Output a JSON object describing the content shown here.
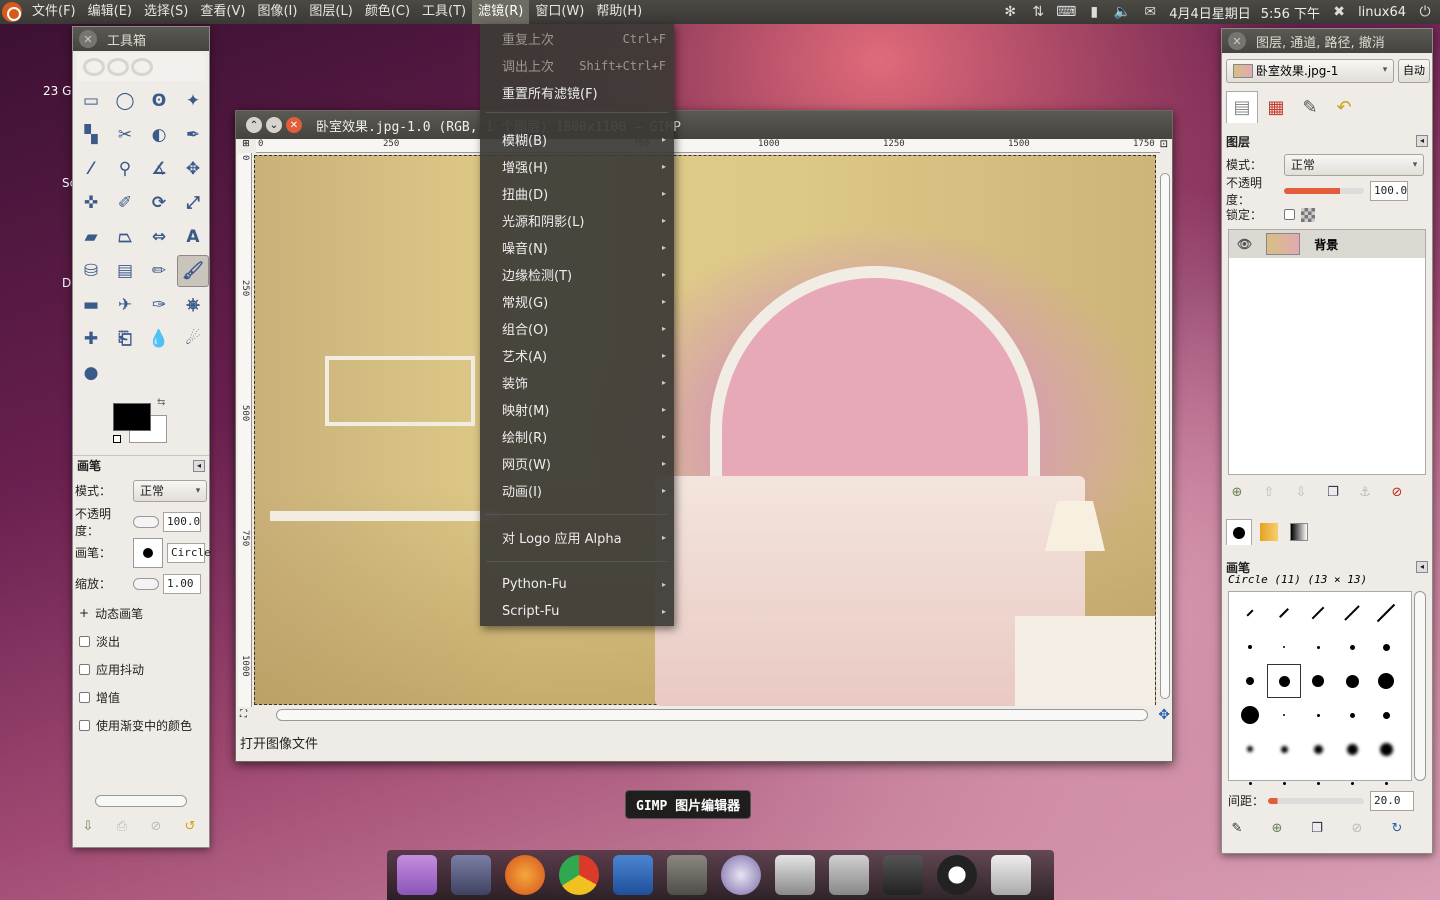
{
  "top_panel": {
    "menus": [
      "文件(F)",
      "编辑(E)",
      "选择(S)",
      "查看(V)",
      "图像(I)",
      "图层(L)",
      "颜色(C)",
      "工具(T)",
      "滤镜(R)",
      "窗口(W)",
      "帮助(H)"
    ],
    "active_menu": "滤镜(R)",
    "date": "4月4日星期日",
    "time": "5:56 下午",
    "user": "linux64"
  },
  "desktop": {
    "labels": [
      "23 G",
      "Sc",
      "Dc"
    ]
  },
  "toolbox": {
    "title": "工具箱",
    "brush_panel": {
      "title": "画笔",
      "mode_label": "模式：",
      "mode_value": "正常",
      "opacity_label": "不透明度：",
      "opacity_value": "100.0",
      "brush_label": "画笔：",
      "brush_value": "Circle",
      "scale_label": "缩放：",
      "scale_value": "1.00",
      "dynamics_label": "动态画笔",
      "checkboxes": [
        "淡出",
        "应用抖动",
        "增值",
        "使用渐变中的颜色"
      ]
    }
  },
  "image_window": {
    "title": "卧室效果.jpg-1.0 (RGB, 1 个图层) 1800x1100 – GIMP",
    "ruler_ticks": [
      "0",
      "250",
      "500",
      "750",
      "1000",
      "1250",
      "1500",
      "1750"
    ],
    "vruler_ticks": [
      "0",
      "250",
      "500",
      "750",
      "1000"
    ],
    "status": "打开图像文件"
  },
  "filters_menu": {
    "items": [
      {
        "label": "重复上次",
        "shortcut": "Ctrl+F",
        "disabled": true
      },
      {
        "label": "调出上次",
        "shortcut": "Shift+Ctrl+F",
        "disabled": true
      },
      {
        "label": "重置所有滤镜(F)",
        "shortcut": "",
        "disabled": false
      },
      {
        "label": "模糊(B)",
        "submenu": true
      },
      {
        "label": "增强(H)",
        "submenu": true
      },
      {
        "label": "扭曲(D)",
        "submenu": true
      },
      {
        "label": "光源和阴影(L)",
        "submenu": true
      },
      {
        "label": "噪音(N)",
        "submenu": true
      },
      {
        "label": "边缘检测(T)",
        "submenu": true
      },
      {
        "label": "常规(G)",
        "submenu": true
      },
      {
        "label": "组合(O)",
        "submenu": true
      },
      {
        "label": "艺术(A)",
        "submenu": true
      },
      {
        "label": "装饰",
        "submenu": true
      },
      {
        "label": "映射(M)",
        "submenu": true
      },
      {
        "label": "绘制(R)",
        "submenu": true
      },
      {
        "label": "网页(W)",
        "submenu": true
      },
      {
        "label": "动画(I)",
        "submenu": true
      },
      {
        "label": "对 Logo 应用 Alpha",
        "submenu": true
      },
      {
        "label": "Python-Fu",
        "submenu": true
      },
      {
        "label": "Script-Fu",
        "submenu": true
      }
    ]
  },
  "right_dock": {
    "title": "图层, 通道, 路径, 撤消",
    "image_select": "卧室效果.jpg-1",
    "auto_label": "自动",
    "layers": {
      "title": "图层",
      "mode_label": "模式：",
      "mode_value": "正常",
      "opacity_label": "不透明度：",
      "opacity_value": "100.0",
      "lock_label": "锁定：",
      "items": [
        {
          "name": "背景",
          "visible": true
        }
      ]
    },
    "brushes": {
      "title": "画笔",
      "selected": "Circle (11) (13 × 13)",
      "spacing_label": "间距：",
      "spacing_value": "20.0"
    }
  },
  "dock": {
    "tooltip": "GIMP 图片编辑器",
    "apps": [
      "system-settings-icon",
      "monitor-icon",
      "firefox-icon",
      "chrome-icon",
      "pidgin-icon",
      "gimp-icon",
      "aperture-icon",
      "movie-editor-icon",
      "webcam-icon",
      "clapper-icon",
      "qq-icon",
      "trash-icon"
    ]
  }
}
